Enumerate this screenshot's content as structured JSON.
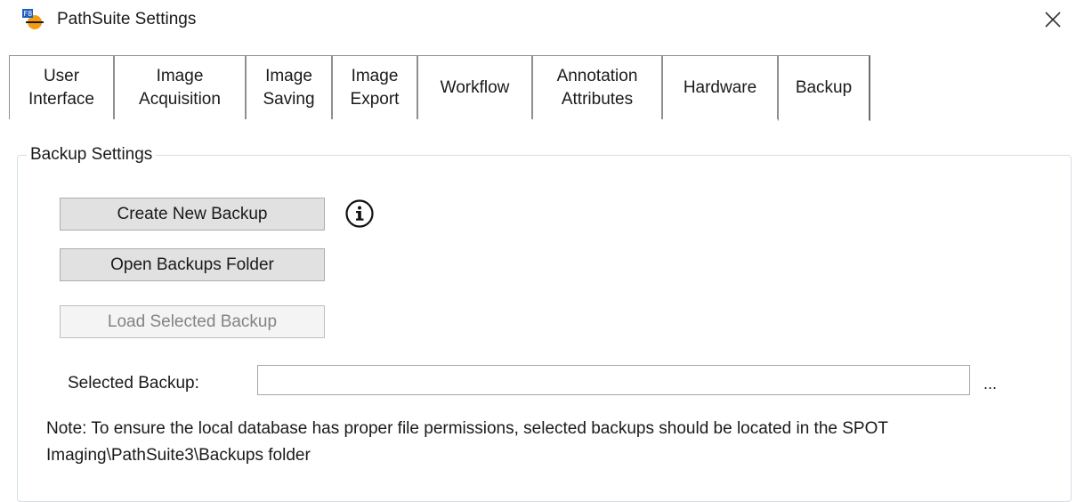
{
  "window": {
    "title": "PathSuite Settings",
    "icon": "pathsuite-app-icon",
    "icon_badge": "F8",
    "close_icon": "close-icon"
  },
  "tabs": [
    {
      "label": "User\nInterface",
      "active": false
    },
    {
      "label": "Image\nAcquisition",
      "active": false
    },
    {
      "label": "Image\nSaving",
      "active": false
    },
    {
      "label": "Image\nExport",
      "active": false
    },
    {
      "label": "Workflow",
      "active": false
    },
    {
      "label": "Annotation\nAttributes",
      "active": false
    },
    {
      "label": "Hardware",
      "active": false
    },
    {
      "label": "Backup",
      "active": true
    }
  ],
  "backup": {
    "group_title": "Backup Settings",
    "create_button": "Create New Backup",
    "info_icon": "info-icon",
    "open_button": "Open Backups Folder",
    "load_button": "Load Selected Backup",
    "load_button_enabled": false,
    "selected_label": "Selected Backup:",
    "selected_value": "",
    "browse_label": "...",
    "note": "Note: To ensure the local database has proper file permissions, selected backups should be located in the SPOT Imaging\\PathSuite3\\Backups folder"
  },
  "colors": {
    "button_bg": "#e1e1e1",
    "button_border": "#adadad",
    "disabled_text": "#838383",
    "icon_orange": "#f39c12",
    "icon_blue": "#1f5fbf"
  }
}
